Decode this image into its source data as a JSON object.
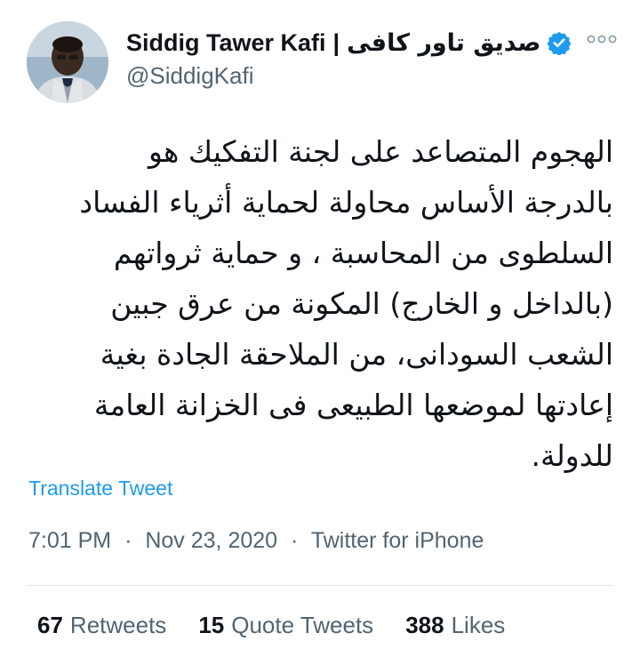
{
  "author": {
    "display_name_en": "Siddig Tawer Kafi",
    "separator": "|",
    "display_name_ar": "صديق تاور كافى",
    "handle": "@SiddigKafi",
    "verified": true
  },
  "icons": {
    "more": "more-options-icon",
    "verified": "verified-badge-icon"
  },
  "tweet": {
    "text": "الهجوم المتصاعد على لجنة التفكيك هو\nبالدرجة الأساس محاولة لحماية أثرياء الفساد\nالسلطوى من المحاسبة ، و حماية ثرواتهم\n(بالداخل و الخارج) المكونة من عرق جبين\nالشعب السودانى، من الملاحقة الجادة بغية\nإعادتها لموضعها الطبيعى فى الخزانة العامة\nللدولة."
  },
  "translate_label": "Translate Tweet",
  "meta": {
    "time": "7:01 PM",
    "date": "Nov 23, 2020",
    "source": "Twitter for iPhone",
    "dot": "·"
  },
  "stats": {
    "retweets_count": "67",
    "retweets_label": "Retweets",
    "quotes_count": "15",
    "quotes_label": "Quote Tweets",
    "likes_count": "388",
    "likes_label": "Likes"
  },
  "colors": {
    "link": "#1d9bf0",
    "secondary_text": "#536471",
    "primary_text": "#0f1419",
    "verified": "#1d9bf0"
  }
}
